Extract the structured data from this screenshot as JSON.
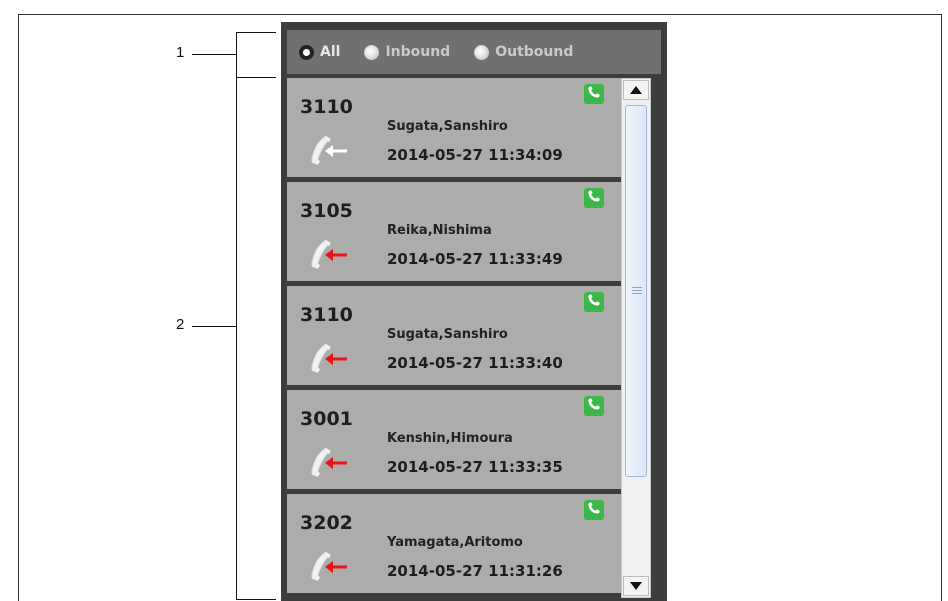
{
  "callouts": [
    {
      "number": "1"
    },
    {
      "number": "2"
    }
  ],
  "filter": {
    "options": [
      {
        "label": "All",
        "selected": true
      },
      {
        "label": "Inbound",
        "selected": false
      },
      {
        "label": "Outbound",
        "selected": false
      }
    ]
  },
  "calls": [
    {
      "extension": "3110",
      "name": "Sugata,Sanshiro",
      "timestamp": "2014-05-27 11:34:09",
      "direction": "inbound",
      "arrow_color": "#ffffff"
    },
    {
      "extension": "3105",
      "name": "Reika,Nishima",
      "timestamp": "2014-05-27 11:33:49",
      "direction": "inbound",
      "arrow_color": "#e8141b"
    },
    {
      "extension": "3110",
      "name": "Sugata,Sanshiro",
      "timestamp": "2014-05-27 11:33:40",
      "direction": "inbound",
      "arrow_color": "#e8141b"
    },
    {
      "extension": "3001",
      "name": "Kenshin,Himoura",
      "timestamp": "2014-05-27 11:33:35",
      "direction": "inbound",
      "arrow_color": "#e8141b"
    },
    {
      "extension": "3202",
      "name": "Yamagata,Aritomo",
      "timestamp": "2014-05-27 11:31:26",
      "direction": "inbound",
      "arrow_color": "#e8141b"
    }
  ],
  "icons": {
    "call_button": "phone-icon",
    "direction": "incoming-call-icon",
    "scroll_up": "arrow-up-icon",
    "scroll_down": "arrow-down-icon"
  },
  "colors": {
    "panel_bg": "#3c3e3e",
    "filter_bg": "#6f7071",
    "item_bg": "#acacab",
    "call_button": "#3cb84a"
  }
}
